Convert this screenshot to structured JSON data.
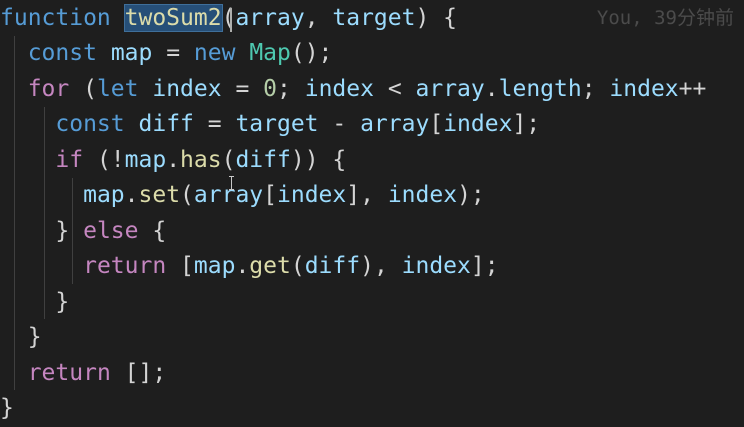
{
  "editor": {
    "blame_annotation": "You, 39分钟前",
    "lines": [
      {
        "text": "function twoSum2(array, target) {"
      },
      {
        "text": "  const map = new Map();"
      },
      {
        "text": "  for (let index = 0; index < array.length; index++"
      },
      {
        "text": "    const diff = target - array[index];"
      },
      {
        "text": "    if (!map.has(diff)) {"
      },
      {
        "text": "      map.set(array[index], index);"
      },
      {
        "text": "    } else {"
      },
      {
        "text": "      return [map.get(diff), index];"
      },
      {
        "text": "    }"
      },
      {
        "text": "  }"
      },
      {
        "text": "  return [];"
      },
      {
        "text": "}"
      }
    ],
    "selected_word": "twoSum2",
    "colors": {
      "background": "#1e1e1e",
      "keyword": "#569cd6",
      "control": "#c586c0",
      "function": "#dcdcaa",
      "variable": "#9cdcfe",
      "number": "#b5cea8",
      "type": "#4ec9b0",
      "selection": "#264f78"
    }
  }
}
